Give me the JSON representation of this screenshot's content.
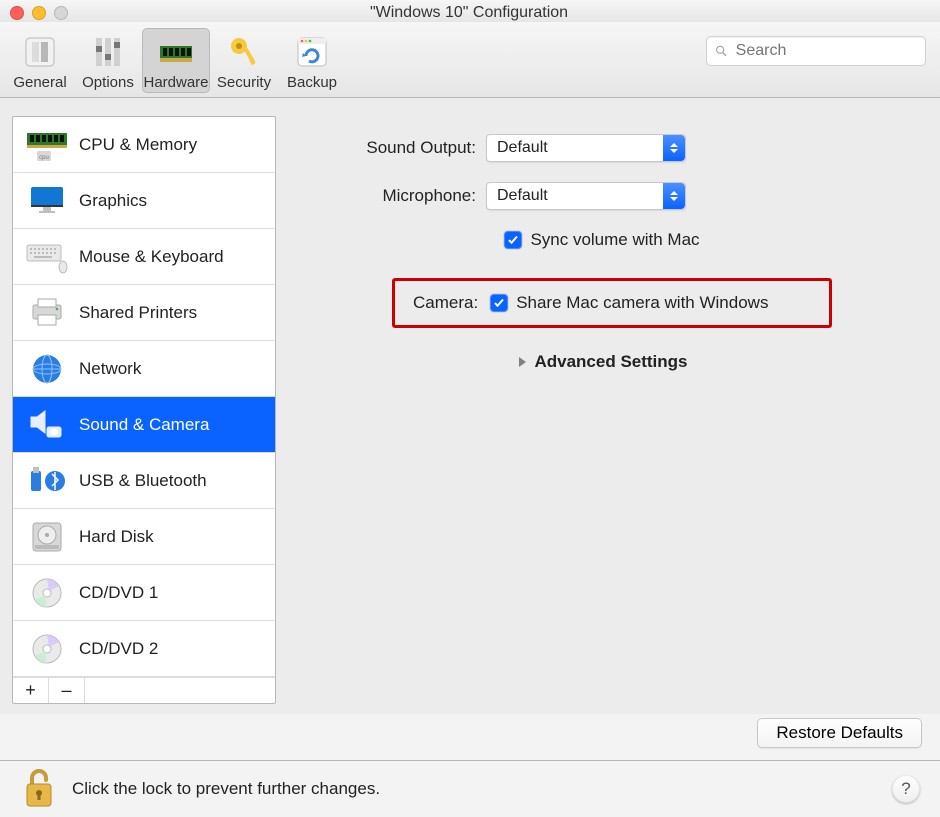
{
  "window": {
    "title": "\"Windows 10\" Configuration"
  },
  "toolbar": {
    "tabs": [
      {
        "label": "General"
      },
      {
        "label": "Options"
      },
      {
        "label": "Hardware"
      },
      {
        "label": "Security"
      },
      {
        "label": "Backup"
      }
    ],
    "selected_index": 2,
    "search_placeholder": "Search"
  },
  "sidebar": {
    "items": [
      {
        "label": "CPU & Memory"
      },
      {
        "label": "Graphics"
      },
      {
        "label": "Mouse & Keyboard"
      },
      {
        "label": "Shared Printers"
      },
      {
        "label": "Network"
      },
      {
        "label": "Sound & Camera"
      },
      {
        "label": "USB & Bluetooth"
      },
      {
        "label": "Hard Disk"
      },
      {
        "label": "CD/DVD 1"
      },
      {
        "label": "CD/DVD 2"
      }
    ],
    "selected_index": 5,
    "add_label": "+",
    "remove_label": "–"
  },
  "pane": {
    "sound_output_label": "Sound Output:",
    "sound_output_value": "Default",
    "microphone_label": "Microphone:",
    "microphone_value": "Default",
    "sync_volume_label": "Sync volume with Mac",
    "sync_volume_checked": true,
    "camera_label": "Camera:",
    "camera_share_label": "Share Mac camera with Windows",
    "camera_share_checked": true,
    "advanced_label": "Advanced Settings",
    "restore_label": "Restore Defaults"
  },
  "footer": {
    "lock_message": "Click the lock to prevent further changes.",
    "help_label": "?"
  }
}
